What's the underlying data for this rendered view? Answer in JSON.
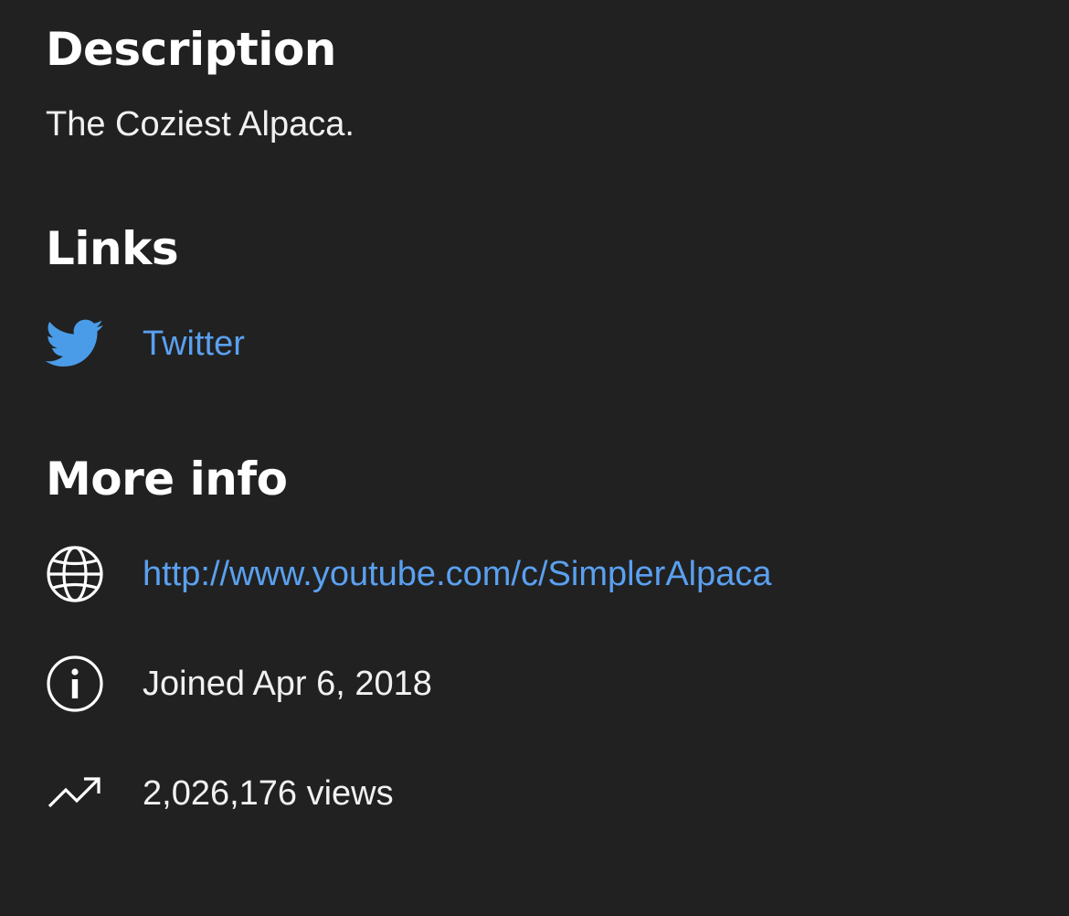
{
  "description": {
    "heading": "Description",
    "text": "The Coziest Alpaca."
  },
  "links": {
    "heading": "Links",
    "items": [
      {
        "label": "Twitter",
        "icon": "twitter-icon"
      }
    ]
  },
  "more_info": {
    "heading": "More info",
    "url": {
      "text": "http://www.youtube.com/c/SimplerAlpaca",
      "icon": "globe-icon"
    },
    "joined": {
      "text": "Joined Apr 6, 2018",
      "icon": "info-icon"
    },
    "views": {
      "text": "2,026,176 views",
      "icon": "trending-up-icon"
    }
  },
  "colors": {
    "background": "#212121",
    "link": "#5aa0f0",
    "twitter": "#4a9ce8",
    "text": "#f1f1f1"
  }
}
